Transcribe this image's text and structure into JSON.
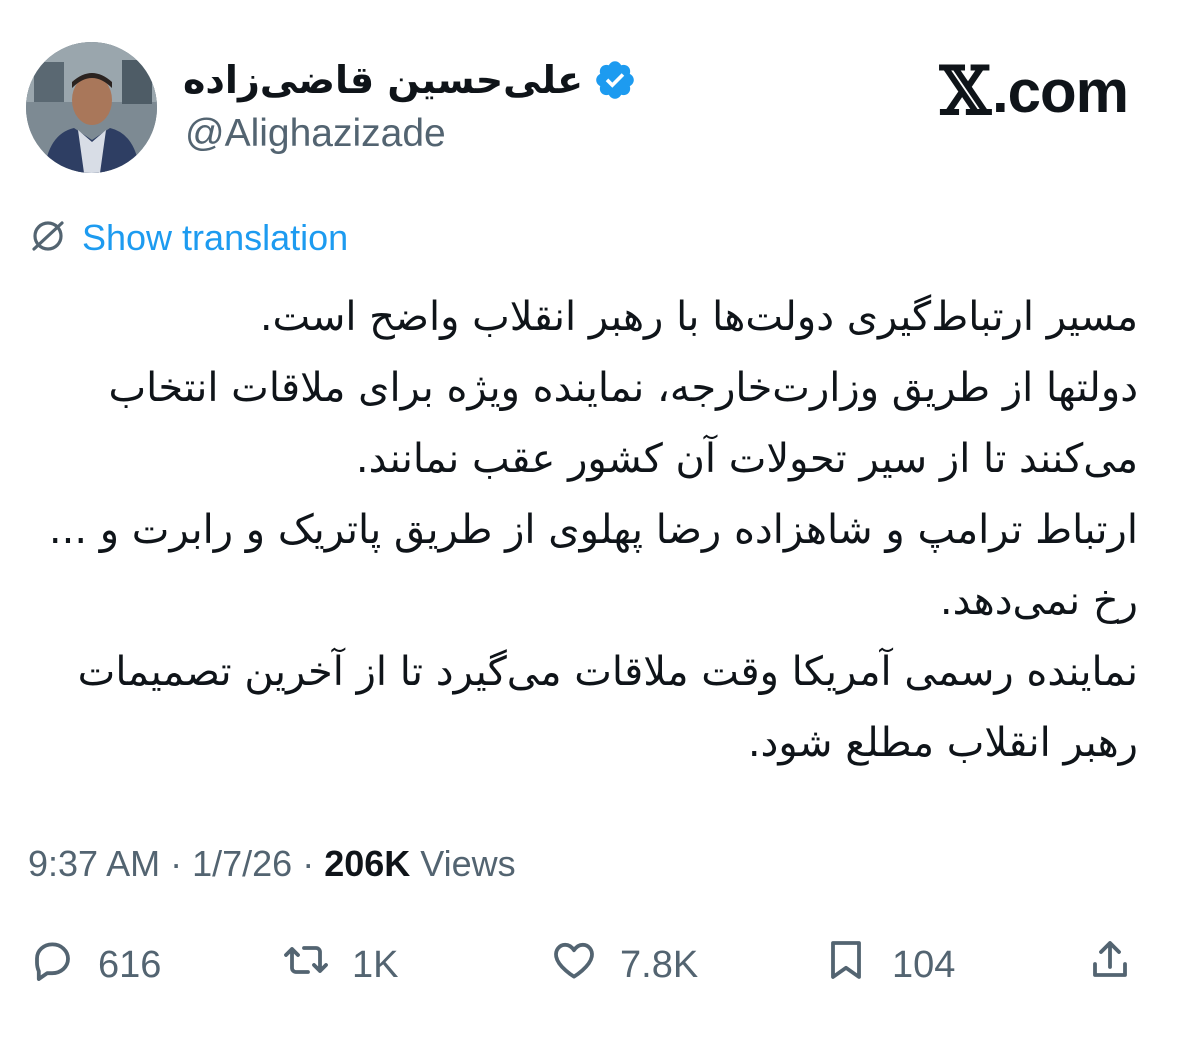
{
  "author": {
    "display_name": "علی‌حسین قاضی‌زاده",
    "handle": "@Alighazizade",
    "verified_icon": "verified-badge-icon",
    "avatar_icon": "avatar"
  },
  "brand": {
    "symbol": "𝕏",
    "label": ".com"
  },
  "translation": {
    "label": "Show translation",
    "icon": "globe-translate-icon"
  },
  "tweet": {
    "text": "مسیر ارتباط‌گیری دولت‌ها با رهبر انقلاب واضح است.\nدولتها از طریق وزارت‌خارجه، نماینده ویژه برای ملاقات انتخاب می‌کنند تا از سیر تحولات آن کشور عقب نمانند.\nارتباط ترامپ و شاهزاده رضا پهلوی از طریق پاتریک و رابرت و ... رخ نمی‌دهد.\nنماینده رسمی آمریکا وقت ملاقات می‌گیرد تا از آخرین تصمیمات رهبر انقلاب مطلع شود."
  },
  "meta": {
    "time": "9:37 AM",
    "separator": "·",
    "date": "1/7/26",
    "views_count": "206K",
    "views_label": "Views"
  },
  "actions": {
    "replies": "616",
    "reposts": "1K",
    "likes": "7.8K",
    "bookmarks": "104"
  },
  "colors": {
    "accent": "#1d9bf0",
    "text": "#0f1419",
    "muted": "#536471"
  }
}
